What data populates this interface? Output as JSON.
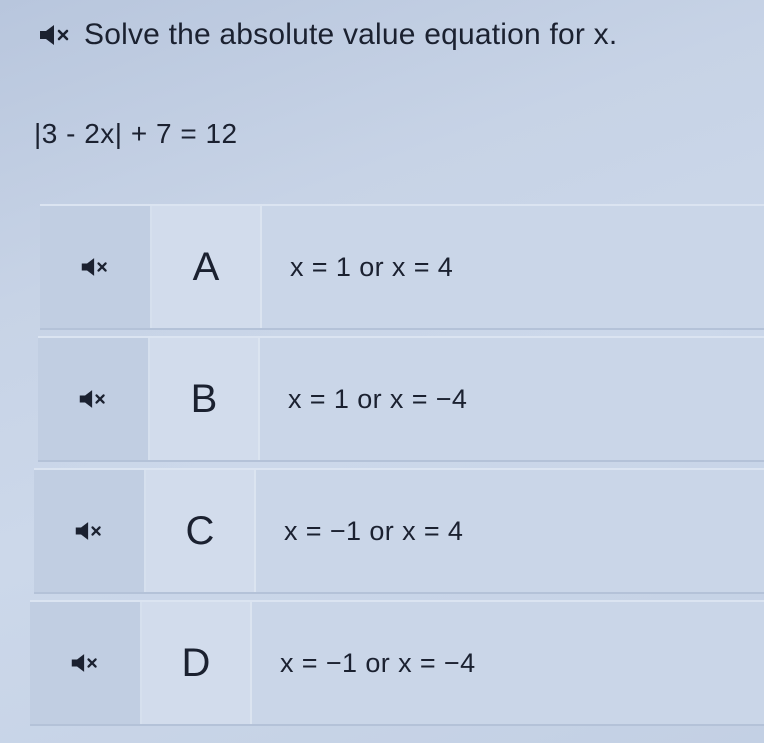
{
  "question": {
    "prompt": "Solve the absolute value equation for x.",
    "equation": "|3 - 2x| + 7 = 12",
    "audio_icon": "speaker-muted-icon"
  },
  "choices": [
    {
      "letter": "A",
      "answer": "x = 1 or x = 4",
      "audio_icon": "speaker-muted-icon"
    },
    {
      "letter": "B",
      "answer": "x = 1 or x = −4",
      "audio_icon": "speaker-muted-icon"
    },
    {
      "letter": "C",
      "answer": "x = −1 or x = 4",
      "audio_icon": "speaker-muted-icon"
    },
    {
      "letter": "D",
      "answer": "x = −1 or x = −4",
      "audio_icon": "speaker-muted-icon"
    }
  ],
  "colors": {
    "text": "#1b2130",
    "background": "#c7d3e6",
    "choice_background": "#cad6e8"
  }
}
